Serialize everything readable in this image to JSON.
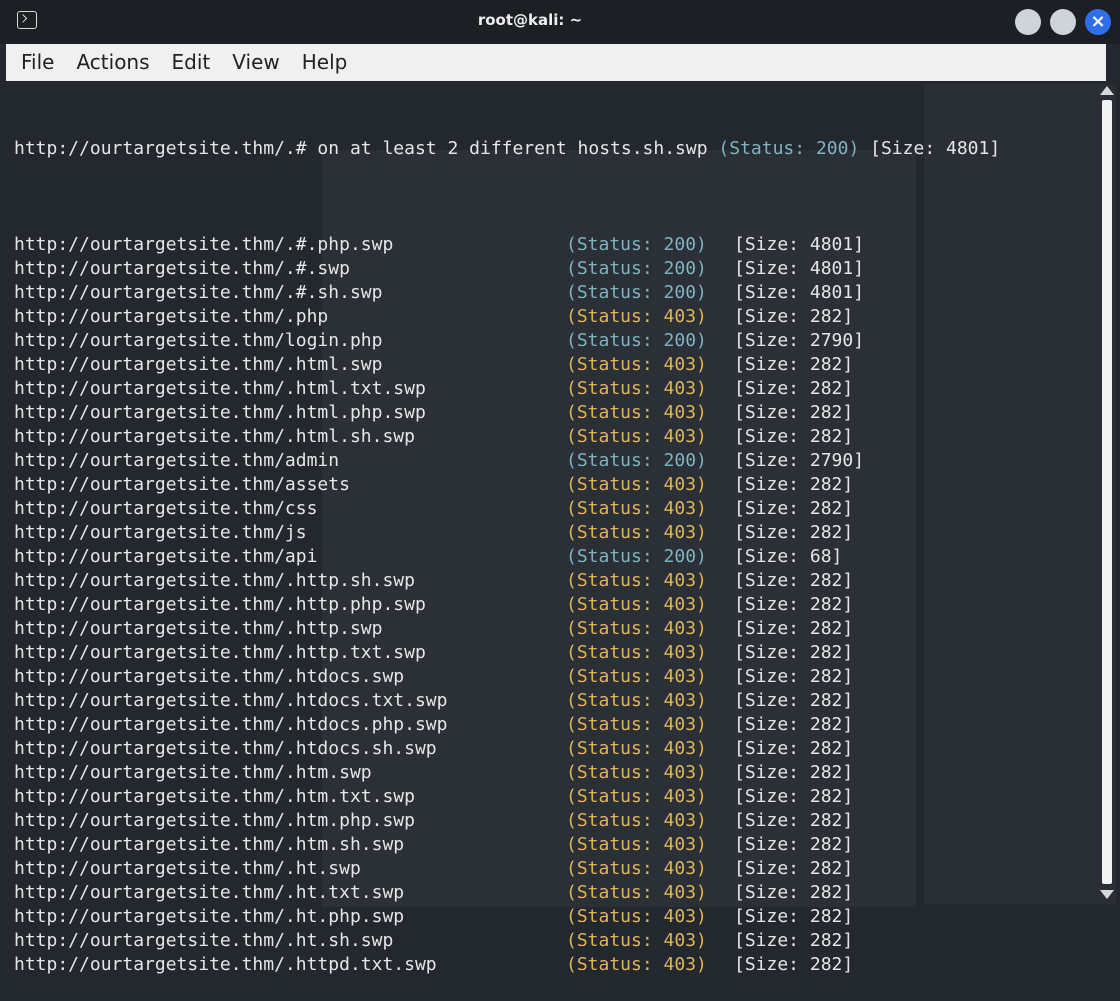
{
  "window": {
    "title": "root@kali: ~"
  },
  "menu": [
    "File",
    "Actions",
    "Edit",
    "View",
    "Help"
  ],
  "first_line": {
    "url": "http://ourtargetsite.thm/.# on at least 2 different hosts.sh.swp ",
    "status": "(Status: 200)",
    "size": " [Size: 4801]"
  },
  "rows": [
    {
      "url": "http://ourtargetsite.thm/.#.php.swp",
      "status": "(Status: 200)",
      "code": "200",
      "size": "[Size: 4801]"
    },
    {
      "url": "http://ourtargetsite.thm/.#.swp",
      "status": "(Status: 200)",
      "code": "200",
      "size": "[Size: 4801]"
    },
    {
      "url": "http://ourtargetsite.thm/.#.sh.swp",
      "status": "(Status: 200)",
      "code": "200",
      "size": "[Size: 4801]"
    },
    {
      "url": "http://ourtargetsite.thm/.php",
      "status": "(Status: 403)",
      "code": "403",
      "size": "[Size: 282]"
    },
    {
      "url": "http://ourtargetsite.thm/login.php",
      "status": "(Status: 200)",
      "code": "200",
      "size": "[Size: 2790]"
    },
    {
      "url": "http://ourtargetsite.thm/.html.swp",
      "status": "(Status: 403)",
      "code": "403",
      "size": "[Size: 282]"
    },
    {
      "url": "http://ourtargetsite.thm/.html.txt.swp",
      "status": "(Status: 403)",
      "code": "403",
      "size": "[Size: 282]"
    },
    {
      "url": "http://ourtargetsite.thm/.html.php.swp",
      "status": "(Status: 403)",
      "code": "403",
      "size": "[Size: 282]"
    },
    {
      "url": "http://ourtargetsite.thm/.html.sh.swp",
      "status": "(Status: 403)",
      "code": "403",
      "size": "[Size: 282]"
    },
    {
      "url": "http://ourtargetsite.thm/admin",
      "status": "(Status: 200)",
      "code": "200",
      "size": "[Size: 2790]"
    },
    {
      "url": "http://ourtargetsite.thm/assets",
      "status": "(Status: 403)",
      "code": "403",
      "size": "[Size: 282]"
    },
    {
      "url": "http://ourtargetsite.thm/css",
      "status": "(Status: 403)",
      "code": "403",
      "size": "[Size: 282]"
    },
    {
      "url": "http://ourtargetsite.thm/js",
      "status": "(Status: 403)",
      "code": "403",
      "size": "[Size: 282]"
    },
    {
      "url": "http://ourtargetsite.thm/api",
      "status": "(Status: 200)",
      "code": "200",
      "size": "[Size: 68]"
    },
    {
      "url": "http://ourtargetsite.thm/.http.sh.swp",
      "status": "(Status: 403)",
      "code": "403",
      "size": "[Size: 282]"
    },
    {
      "url": "http://ourtargetsite.thm/.http.php.swp",
      "status": "(Status: 403)",
      "code": "403",
      "size": "[Size: 282]"
    },
    {
      "url": "http://ourtargetsite.thm/.http.swp",
      "status": "(Status: 403)",
      "code": "403",
      "size": "[Size: 282]"
    },
    {
      "url": "http://ourtargetsite.thm/.http.txt.swp",
      "status": "(Status: 403)",
      "code": "403",
      "size": "[Size: 282]"
    },
    {
      "url": "http://ourtargetsite.thm/.htdocs.swp",
      "status": "(Status: 403)",
      "code": "403",
      "size": "[Size: 282]"
    },
    {
      "url": "http://ourtargetsite.thm/.htdocs.txt.swp",
      "status": "(Status: 403)",
      "code": "403",
      "size": "[Size: 282]"
    },
    {
      "url": "http://ourtargetsite.thm/.htdocs.php.swp",
      "status": "(Status: 403)",
      "code": "403",
      "size": "[Size: 282]"
    },
    {
      "url": "http://ourtargetsite.thm/.htdocs.sh.swp",
      "status": "(Status: 403)",
      "code": "403",
      "size": "[Size: 282]"
    },
    {
      "url": "http://ourtargetsite.thm/.htm.swp",
      "status": "(Status: 403)",
      "code": "403",
      "size": "[Size: 282]"
    },
    {
      "url": "http://ourtargetsite.thm/.htm.txt.swp",
      "status": "(Status: 403)",
      "code": "403",
      "size": "[Size: 282]"
    },
    {
      "url": "http://ourtargetsite.thm/.htm.php.swp",
      "status": "(Status: 403)",
      "code": "403",
      "size": "[Size: 282]"
    },
    {
      "url": "http://ourtargetsite.thm/.htm.sh.swp",
      "status": "(Status: 403)",
      "code": "403",
      "size": "[Size: 282]"
    },
    {
      "url": "http://ourtargetsite.thm/.ht.swp",
      "status": "(Status: 403)",
      "code": "403",
      "size": "[Size: 282]"
    },
    {
      "url": "http://ourtargetsite.thm/.ht.txt.swp",
      "status": "(Status: 403)",
      "code": "403",
      "size": "[Size: 282]"
    },
    {
      "url": "http://ourtargetsite.thm/.ht.php.swp",
      "status": "(Status: 403)",
      "code": "403",
      "size": "[Size: 282]"
    },
    {
      "url": "http://ourtargetsite.thm/.ht.sh.swp",
      "status": "(Status: 403)",
      "code": "403",
      "size": "[Size: 282]"
    },
    {
      "url": "http://ourtargetsite.thm/.httpd.txt.swp",
      "status": "(Status: 403)",
      "code": "403",
      "size": "[Size: 282]"
    }
  ],
  "colors": {
    "status_200": "#7fb3c2",
    "status_403": "#e0b55a",
    "terminal_bg": "#23272e",
    "close_button": "#2f6fe8"
  }
}
